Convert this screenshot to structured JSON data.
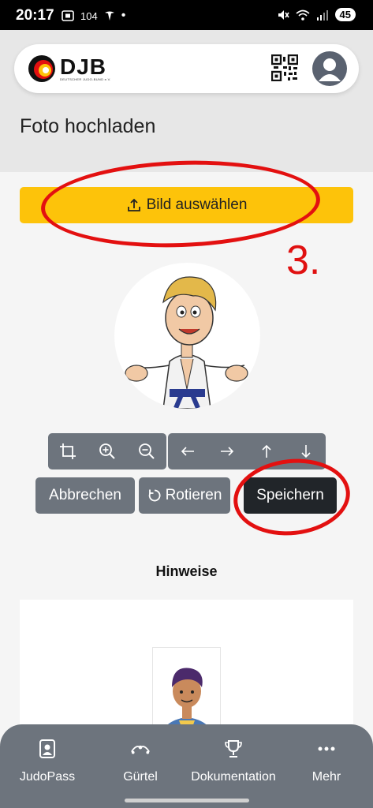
{
  "status_bar": {
    "time": "20:17",
    "left_text": "104",
    "battery": "45"
  },
  "header": {
    "logo_text": "DJB",
    "logo_subtext": "DEUTSCHER JUDO-BUND e.V.",
    "qr_icon": "qr-code-icon",
    "avatar_icon": "user-avatar-icon"
  },
  "page": {
    "title": "Foto hochladen",
    "select_button_label": "Bild auswählen",
    "step_annotation": "3."
  },
  "editor": {
    "tools": [
      "crop-icon",
      "zoom-in-icon",
      "zoom-out-icon",
      "arrow-left-icon",
      "arrow-right-icon",
      "arrow-up-icon",
      "arrow-down-icon"
    ],
    "cancel_label": "Abbrechen",
    "rotate_label": "Rotieren",
    "save_label": "Speichern"
  },
  "hints": {
    "title": "Hinweise"
  },
  "bottom_nav": [
    {
      "label": "JudoPass",
      "icon": "id-card-icon"
    },
    {
      "label": "Gürtel",
      "icon": "belt-icon"
    },
    {
      "label": "Dokumentation",
      "icon": "trophy-icon"
    },
    {
      "label": "Mehr",
      "icon": "more-icon"
    }
  ],
  "colors": {
    "accent_yellow": "#fdc30a",
    "button_gray": "#6d747d",
    "save_dark": "#212529",
    "annotation_red": "#e31010"
  }
}
